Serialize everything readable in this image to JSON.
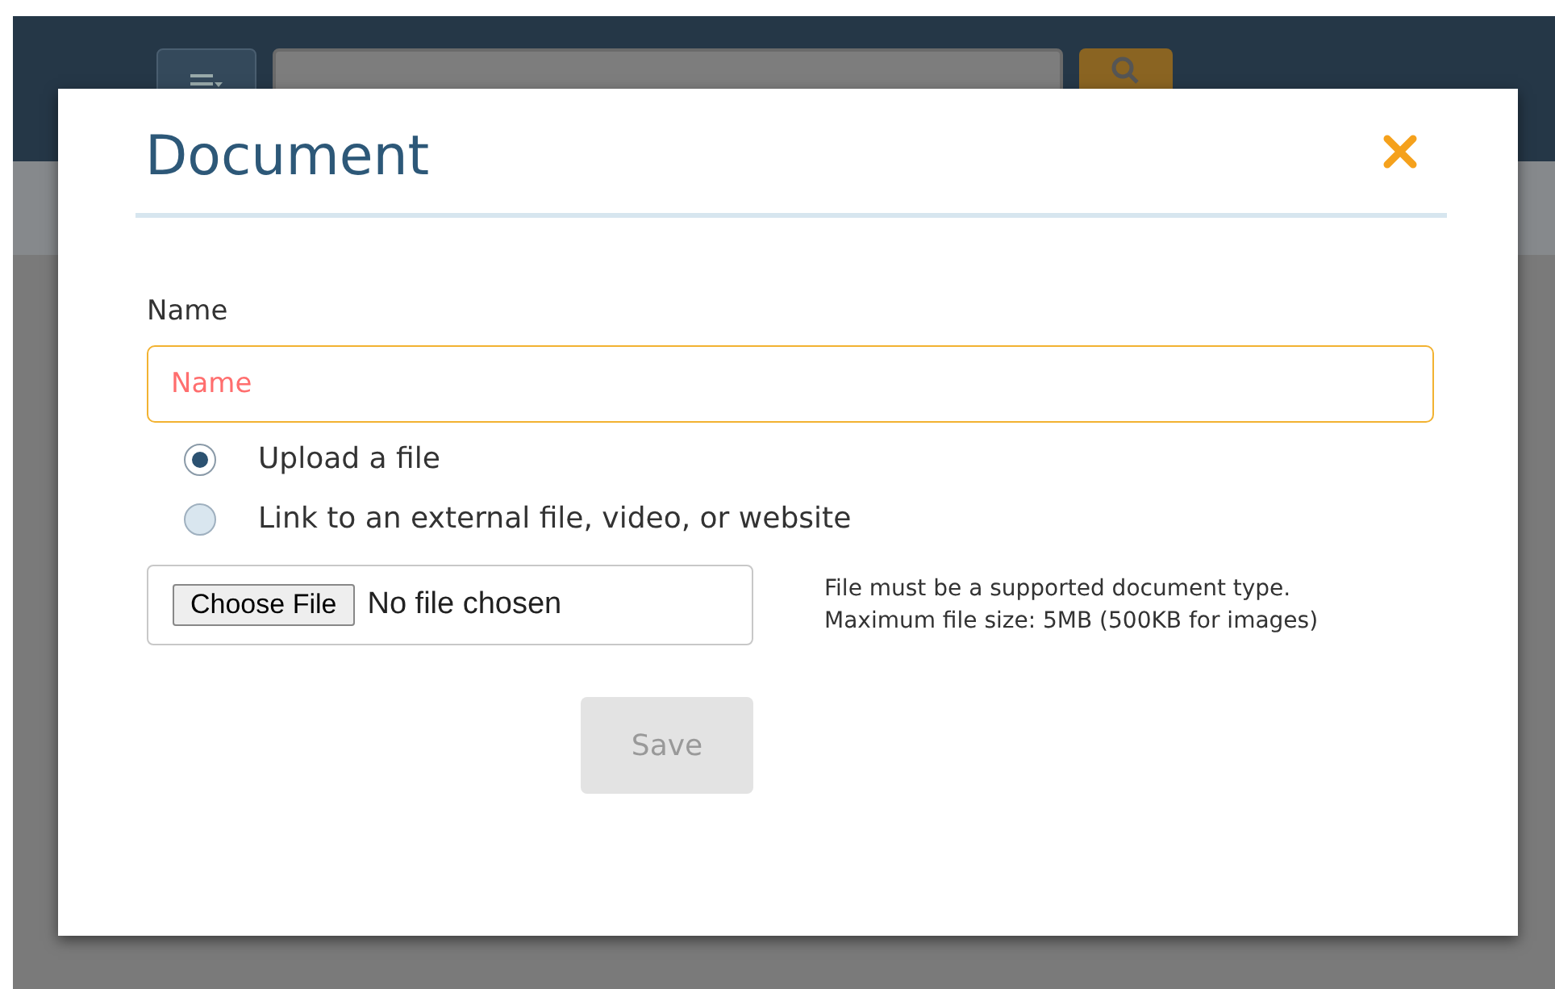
{
  "dialog": {
    "title": "Document",
    "name_field": {
      "label": "Name",
      "placeholder": "Name"
    },
    "source_options": [
      {
        "label": "Upload a file",
        "selected": true
      },
      {
        "label": "Link to an external file, video, or website",
        "selected": false
      }
    ],
    "file_input": {
      "button": "Choose File",
      "status": "No file chosen"
    },
    "help_lines": [
      "File must be a supported document type.",
      "Maximum file size: 5MB (500KB for images)"
    ],
    "save": {
      "label": "Save",
      "disabled": true
    }
  }
}
